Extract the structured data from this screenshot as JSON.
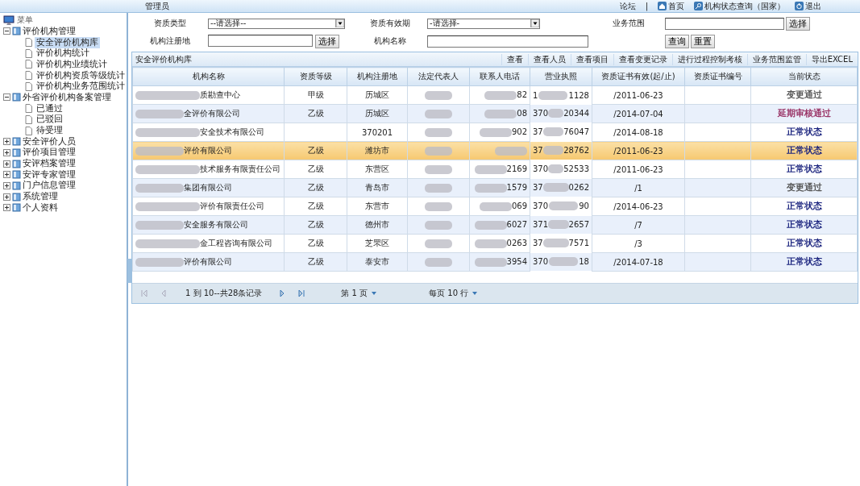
{
  "header": {
    "user": "管理员",
    "links": [
      "论坛",
      "首页",
      "机构状态查询（国家）",
      "退出"
    ],
    "separator": "|"
  },
  "sidebar": {
    "title": "菜单",
    "tree": [
      {
        "label": "评价机构管理",
        "expanded": true,
        "children": [
          {
            "label": "安全评价机构库",
            "selected": true
          },
          {
            "label": "评价机构统计",
            "selected": false
          },
          {
            "label": "评价机构业绩统计",
            "selected": false
          },
          {
            "label": "评价机构资质等级统计",
            "selected": false
          },
          {
            "label": "评价机构业务范围统计",
            "selected": false
          }
        ]
      },
      {
        "label": "外省评价机构备案管理",
        "expanded": true,
        "children": [
          {
            "label": "已通过",
            "selected": false
          },
          {
            "label": "已驳回",
            "selected": false
          },
          {
            "label": "待受理",
            "selected": false
          }
        ]
      },
      {
        "label": "安全评价人员",
        "expanded": false
      },
      {
        "label": "评价项目管理",
        "expanded": false
      },
      {
        "label": "安评档案管理",
        "expanded": false
      },
      {
        "label": "安评专家管理",
        "expanded": false
      },
      {
        "label": "门户信息管理",
        "expanded": false
      },
      {
        "label": "系统管理",
        "expanded": false
      },
      {
        "label": "个人资料",
        "expanded": false
      }
    ]
  },
  "filters": {
    "qual_type": {
      "label": "资质类型",
      "value": "--请选择--"
    },
    "qual_period": {
      "label": "资质有效期",
      "value": "-请选择-"
    },
    "scope": {
      "label": "业务范围",
      "button": "选择"
    },
    "place": {
      "label": "机构注册地",
      "button": "选择"
    },
    "name": {
      "label": "机构名称"
    },
    "query": "查询",
    "reset": "重置"
  },
  "grid": {
    "title": "安全评价机构库",
    "actions": [
      "查看",
      "查看人员",
      "查看项目",
      "查看变更记录",
      "进行过程控制考核",
      "业务范围监管",
      "导出EXCEL"
    ],
    "columns": [
      "机构名称",
      "资质等级",
      "机构注册地",
      "法定代表人",
      "联系人电话",
      "营业执照",
      "资质证书有效(起/止)",
      "资质证书编号",
      "当前状态"
    ],
    "rows": [
      {
        "selected": false,
        "name": "质勘查中心",
        "grade": "甲级",
        "place": "历城区",
        "phone": "82",
        "license_head": "1",
        "license_tail": "1128",
        "cert": "/2011-06-23",
        "status": "变更通过",
        "color": "#555555"
      },
      {
        "selected": false,
        "name": "全评价有限公司",
        "grade": "乙级",
        "place": "历城区",
        "phone": "08",
        "license_head": "370",
        "license_tail": "20344",
        "cert": "/2014-07-04",
        "status": "延期审核通过",
        "color": "#993366"
      },
      {
        "selected": false,
        "name": "安全技术有限公司",
        "place": "370201",
        "phone": "902",
        "license_head": "37",
        "license_tail": "76047",
        "cert": "/2014-08-18",
        "status": "正常状态",
        "color": "#1a237e"
      },
      {
        "selected": true,
        "name": "评价有限公司",
        "grade": "乙级",
        "place": "潍坊市",
        "license_head": "37",
        "license_tail": "28762",
        "cert": "/2011-06-23",
        "status": "正常状态",
        "color": "#1a237e"
      },
      {
        "selected": false,
        "name": "技术服务有限责任公司",
        "grade": "乙级",
        "place": "东营区",
        "phone": "2169",
        "license_head": "370",
        "license_tail": "52533",
        "cert": "/2011-06-23",
        "status": "正常状态",
        "color": "#1a237e"
      },
      {
        "selected": false,
        "name": "集团有限公司",
        "grade": "乙级",
        "place": "青岛市",
        "phone": "1579",
        "license_head": "37",
        "license_tail": "0262",
        "cert": "/1",
        "status": "变更通过",
        "color": "#555555"
      },
      {
        "selected": false,
        "name": "评价有限责任公司",
        "grade": "乙级",
        "place": "东营市",
        "phone": "069",
        "license_head": "370",
        "license_tail": "90",
        "cert": "/2014-06-23",
        "status": "正常状态",
        "color": "#1a237e"
      },
      {
        "selected": false,
        "name": "安全服务有限公司",
        "grade": "乙级",
        "place": "德州市",
        "phone": "6027",
        "license_head": "371",
        "license_tail": "2657",
        "cert": "/7",
        "status": "正常状态",
        "color": "#1a237e"
      },
      {
        "selected": false,
        "name": "金工程咨询有限公司",
        "grade": "乙级",
        "place": "芝罘区",
        "phone": "0263",
        "license_head": "37",
        "license_tail": "7571",
        "cert": "/3",
        "status": "正常状态",
        "color": "#1a237e"
      },
      {
        "selected": false,
        "name": "评价有限公司",
        "grade": "乙级",
        "place": "泰安市",
        "phone": "3954",
        "license_head": "370",
        "license_tail": "18",
        "cert": "/2014-07-18",
        "status": "正常状态",
        "color": "#1a237e"
      }
    ]
  },
  "pager": {
    "range": "1 到 10--共28条记录",
    "page": "第 1 页",
    "per_page": "每页 10 行"
  }
}
